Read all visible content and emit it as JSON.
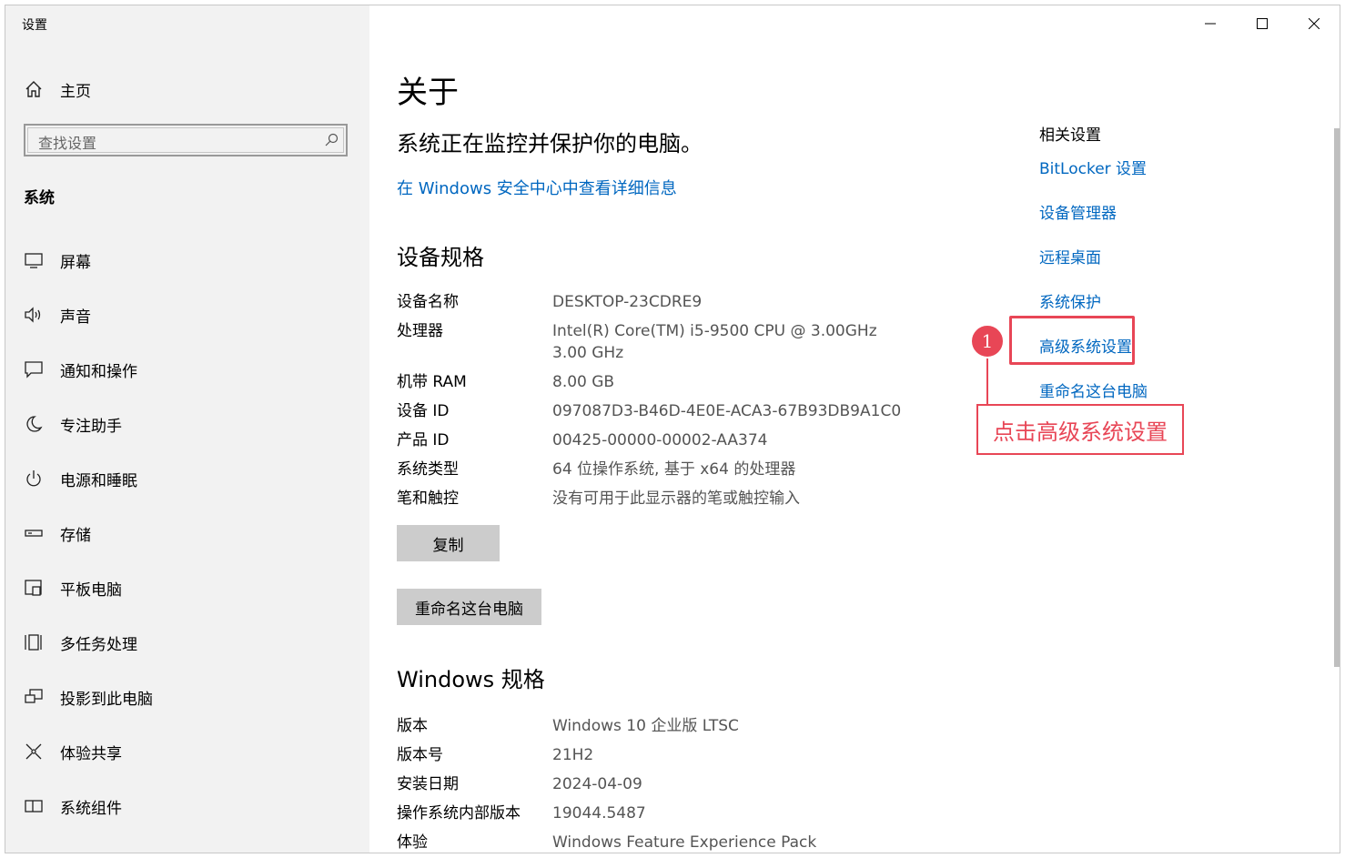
{
  "window": {
    "title": "设置"
  },
  "sidebar": {
    "home_label": "主页",
    "search_placeholder": "查找设置",
    "section_label": "系统",
    "items": [
      {
        "label": "屏幕",
        "icon": "monitor-icon"
      },
      {
        "label": "声音",
        "icon": "speaker-icon"
      },
      {
        "label": "通知和操作",
        "icon": "notification-icon"
      },
      {
        "label": "专注助手",
        "icon": "moon-icon"
      },
      {
        "label": "电源和睡眠",
        "icon": "power-icon"
      },
      {
        "label": "存储",
        "icon": "storage-icon"
      },
      {
        "label": "平板电脑",
        "icon": "tablet-icon"
      },
      {
        "label": "多任务处理",
        "icon": "multitask-icon"
      },
      {
        "label": "投影到此电脑",
        "icon": "project-icon"
      },
      {
        "label": "体验共享",
        "icon": "share-icon"
      },
      {
        "label": "系统组件",
        "icon": "components-icon"
      }
    ]
  },
  "main": {
    "title": "关于",
    "subtitle": "系统正在监控并保护你的电脑。",
    "security_link": "在 Windows 安全中心中查看详细信息",
    "device_spec_title": "设备规格",
    "device_specs": [
      {
        "key": "设备名称",
        "value": "DESKTOP-23CDRE9"
      },
      {
        "key": "处理器",
        "value": "Intel(R) Core(TM) i5-9500 CPU @ 3.00GHz   3.00 GHz"
      },
      {
        "key": "机带 RAM",
        "value": "8.00 GB"
      },
      {
        "key": "设备 ID",
        "value": "097087D3-B46D-4E0E-ACA3-67B93DB9A1C0"
      },
      {
        "key": "产品 ID",
        "value": "00425-00000-00002-AA374"
      },
      {
        "key": "系统类型",
        "value": "64 位操作系统, 基于 x64 的处理器"
      },
      {
        "key": "笔和触控",
        "value": "没有可用于此显示器的笔或触控输入"
      }
    ],
    "copy_button": "复制",
    "rename_button": "重命名这台电脑",
    "windows_spec_title": "Windows 规格",
    "windows_specs": [
      {
        "key": "版本",
        "value": "Windows 10 企业版 LTSC"
      },
      {
        "key": "版本号",
        "value": "21H2"
      },
      {
        "key": "安装日期",
        "value": "2024-04-09"
      },
      {
        "key": "操作系统内部版本",
        "value": "19044.5487"
      },
      {
        "key": "体验",
        "value": "Windows Feature Experience Pack"
      }
    ]
  },
  "related": {
    "heading": "相关设置",
    "links": [
      "BitLocker 设置",
      "设备管理器",
      "远程桌面",
      "系统保护",
      "高级系统设置",
      "重命名这台电脑"
    ]
  },
  "annotation": {
    "badge": "1",
    "text": "点击高级系统设置",
    "color": "#e84656"
  },
  "colors": {
    "link": "#0067c0",
    "sidebar_bg": "#f2f2f2",
    "button_bg": "#cccccc"
  }
}
